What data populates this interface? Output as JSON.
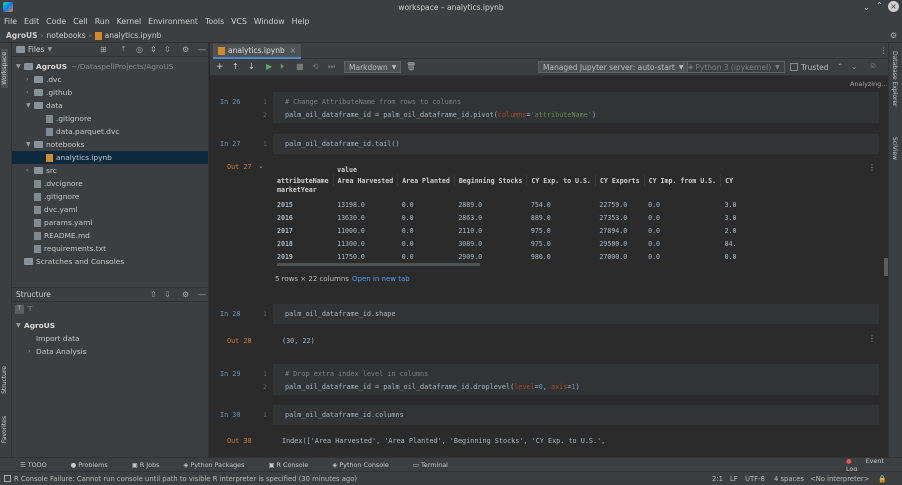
{
  "window": {
    "title": "workspace – analytics.ipynb"
  },
  "menu": [
    "File",
    "Edit",
    "Code",
    "Cell",
    "Run",
    "Kernel",
    "Environment",
    "Tools",
    "VCS",
    "Window",
    "Help"
  ],
  "breadcrumb": [
    "AgroUS",
    "notebooks",
    "analytics.ipynb"
  ],
  "left_stripe": {
    "workspace": "Workspace",
    "structure": "Structure",
    "favorites": "Favorites"
  },
  "right_stripe": {
    "db_explorer": "Database Explorer",
    "sciview": "SciView"
  },
  "project": {
    "header": "Files",
    "root": "AgroUS",
    "root_path": "~/DataspellProjects/AgroUS",
    "items": [
      ".dvc",
      ".github",
      "data",
      ".gitignore",
      "data.parquet.dvc",
      "notebooks",
      "analytics.ipynb",
      "src",
      ".dvcignore",
      ".gitignore",
      "dvc.yaml",
      "params.yaml",
      "README.md",
      "requirements.txt",
      "Scratches and Consoles"
    ]
  },
  "structure": {
    "header": "Structure",
    "root": "AgroUS",
    "items": [
      "Import data",
      "Data Analysis"
    ]
  },
  "editor": {
    "tab": "analytics.ipynb",
    "cell_type": "Markdown",
    "server": "Managed Jupyter server: auto-start",
    "kernel": "Python 3 (ipykernel)",
    "trusted": "Trusted",
    "analyzing": "Analyzing..."
  },
  "cells": {
    "c26": {
      "prompt": "In 26",
      "l1": "1",
      "l2": "2",
      "comment": "# Change AttributeName from rows to columns",
      "code_a": "palm_oil_dataframe_id = palm_oil_dataframe_id.pivot(",
      "kw": "columns",
      "code_b": "=",
      "str": "'attributeName'",
      "code_c": ")"
    },
    "c27": {
      "prompt": "In 27",
      "l1": "1",
      "code": "palm_oil_dataframe_id.tail()",
      "out": "Out 27"
    },
    "c28": {
      "prompt": "In 28",
      "l1": "1",
      "code": "palm_oil_dataframe_id.shape",
      "out": "Out 28",
      "result": "(30, 22)"
    },
    "c29": {
      "prompt": "In 29",
      "l1": "1",
      "l2": "2",
      "comment": "# Drop extra index level in columns",
      "code_a": "palm_oil_dataframe_id = palm_oil_dataframe_id.droplevel(",
      "kw1": "level",
      "eq": "=",
      "n1": "0",
      "sep": ", ",
      "kw2": "axis",
      "n2": "1",
      "code_c": ")"
    },
    "c30": {
      "prompt": "In 30",
      "l1": "1",
      "code": "palm_oil_dataframe_id.columns",
      "out": "Out 30",
      "result": "Index(['Area Harvested', 'Area Planted', 'Beginning Stocks', 'CY Exp. to U.S.',"
    }
  },
  "table": {
    "top_header": "value",
    "index_label": "attributeName",
    "index_name": "marketYear",
    "columns": [
      "Area Harvested",
      "Area Planted",
      "Beginning Stocks",
      "CY Exp. to U.S.",
      "CY Exports",
      "CY Imp. from U.S.",
      "CY"
    ],
    "rows": [
      [
        "2015",
        "13198.0",
        "0.0",
        "2889.0",
        "754.0",
        "22759.0",
        "0.0",
        "3.0"
      ],
      [
        "2016",
        "13630.0",
        "0.0",
        "2863.0",
        "889.0",
        "27353.0",
        "0.0",
        "3.0"
      ],
      [
        "2017",
        "11000.0",
        "0.0",
        "2110.0",
        "975.0",
        "27894.0",
        "0.0",
        "2.0"
      ],
      [
        "2018",
        "11300.0",
        "0.0",
        "3089.0",
        "975.0",
        "29500.0",
        "0.0",
        "84."
      ],
      [
        "2019",
        "11750.0",
        "0.0",
        "2909.0",
        "980.0",
        "27000.0",
        "0.0",
        "0.0"
      ]
    ],
    "summary": "5 rows × 22 columns",
    "link": "Open in new tab"
  },
  "bottom_tabs": [
    "TODO",
    "Problems",
    "R Jobs",
    "Python Packages",
    "R Console",
    "Python Console",
    "Terminal"
  ],
  "event_log": "Event Log",
  "status": {
    "message": "R Console Failure: Cannot run console until path to visible R interpreter is specified (30 minutes ago)",
    "pos": "2:1",
    "lf": "LF",
    "enc": "UTF-8",
    "indent": "4 spaces",
    "interp": "<No interpreter>"
  }
}
